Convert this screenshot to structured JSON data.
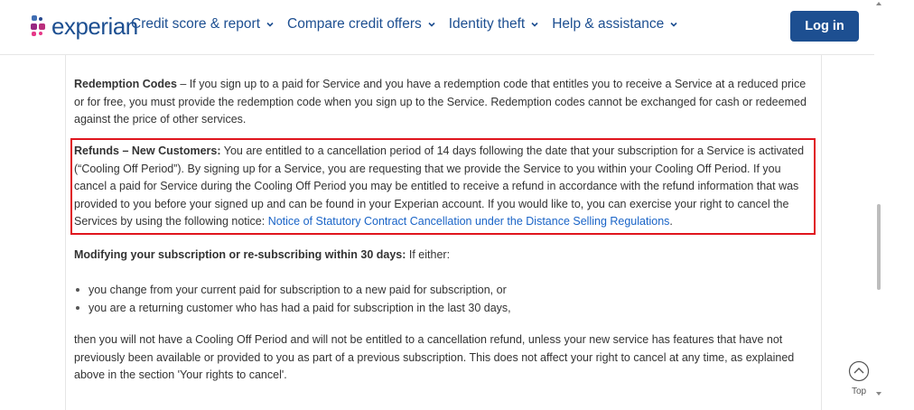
{
  "header": {
    "logo_text": "experian",
    "nav": [
      {
        "label": "Credit score & report"
      },
      {
        "label": "Compare credit offers"
      },
      {
        "label": "Identity theft"
      },
      {
        "label": "Help & assistance"
      }
    ],
    "login_label": "Log in"
  },
  "content": {
    "redemption": {
      "title": "Redemption Codes",
      "text": " – If you sign up to a paid for Service and you have a redemption code that entitles you to receive a Service at a reduced price or for free, you must provide the redemption code when you sign up to the Service. Redemption codes cannot be exchanged for cash or redeemed against the price of other services."
    },
    "refunds": {
      "title": "Refunds – New Customers:",
      "text": " You are entitled to a cancellation period of 14 days following the date that your subscription for a Service is activated (“Cooling Off Period”). By signing up for a Service, you are requesting that we provide the Service to you within your Cooling Off Period. If you cancel a paid for Service during the Cooling Off Period you may be entitled to receive a refund in accordance with the refund information that was provided to you before your signed up and can be found in your Experian account. If you would like to, you can exercise your right to cancel the Services by using the following notice: ",
      "link_text": "Notice of Statutory Contract Cancellation under the Distance Selling Regulations",
      "link_suffix": "."
    },
    "modifying": {
      "title": "Modifying your subscription or re-subscribing within 30 days:",
      "text": " If either:"
    },
    "bullets": [
      "you change from your current paid for subscription to a new paid for subscription, or",
      "you are a returning customer who has had a paid for subscription in the last 30 days,"
    ],
    "closing": "then you will not have a Cooling Off Period and will not be entitled to a cancellation refund, unless your new service has features that have not previously been available or provided to you as part of a previous subscription. This does not affect your right to cancel at any time, as explained above in the section 'Your rights to cancel'."
  },
  "top_button": {
    "label": "Top"
  },
  "colors": {
    "brand": "#1d4f91",
    "highlight": "#e0151e",
    "link": "#1a64c7"
  }
}
